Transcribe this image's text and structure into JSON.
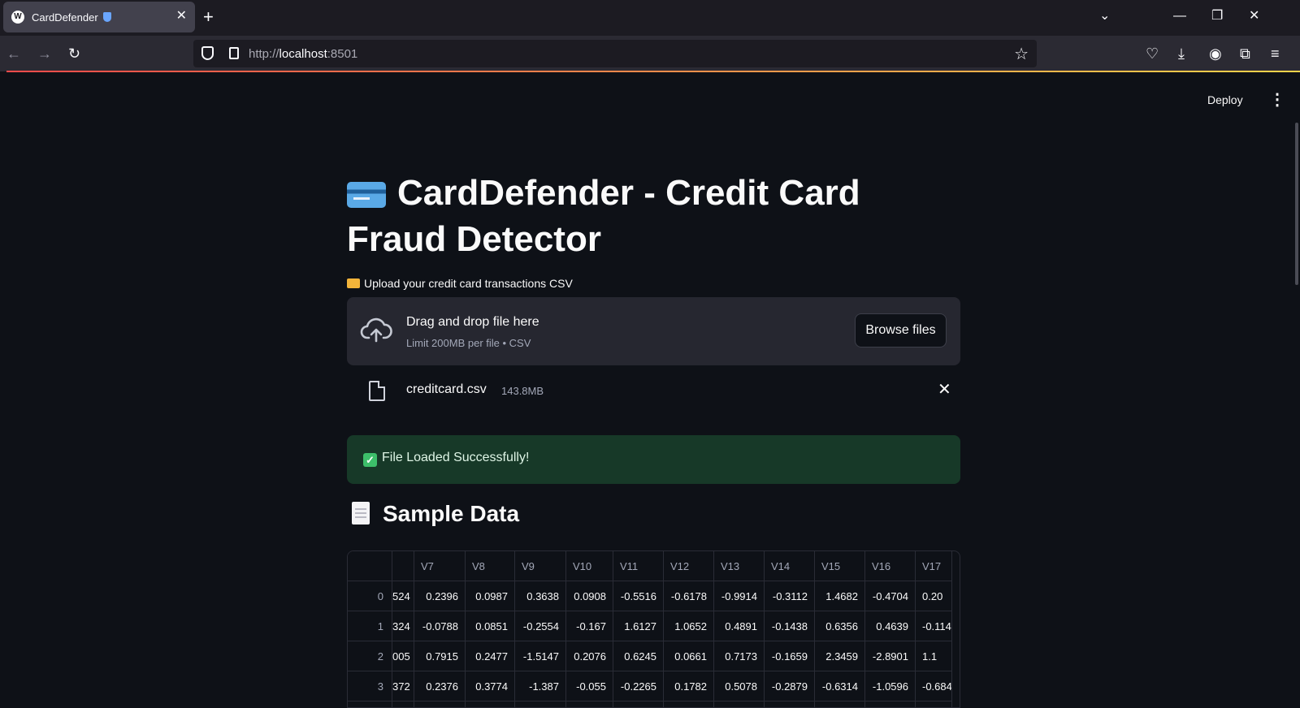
{
  "browser": {
    "tab_title": "CardDefender",
    "tab_favicon": "W",
    "url_prefix": "http://",
    "url_host": "localhost",
    "url_port": ":8501",
    "icons": [
      "back-icon",
      "forward-icon",
      "reload-icon",
      "shield-icon",
      "page-icon",
      "star-icon",
      "pocket-icon",
      "download-icon",
      "account-icon",
      "extensions-icon",
      "menu-icon"
    ]
  },
  "app": {
    "deploy_label": "Deploy",
    "title": "CardDefender - Credit Card Fraud Detector",
    "upload_label": "Upload your credit card transactions CSV",
    "dropzone_title": "Drag and drop file here",
    "dropzone_sub": "Limit 200MB per file • CSV",
    "browse_label": "Browse files",
    "file_name": "creditcard.csv",
    "file_size": "143.8MB",
    "success_text": "File Loaded Successfully!",
    "sample_heading": "Sample Data"
  },
  "table": {
    "index": [
      "0",
      "1",
      "2",
      "3"
    ],
    "columns": [
      "",
      "V7",
      "V8",
      "V9",
      "V10",
      "V11",
      "V12",
      "V13",
      "V14",
      "V15",
      "V16",
      "V17"
    ],
    "rows": [
      [
        "524",
        "0.2396",
        "0.0987",
        "0.3638",
        "0.0908",
        "-0.5516",
        "-0.6178",
        "-0.9914",
        "-0.3112",
        "1.4682",
        "-0.4704",
        "0.20"
      ],
      [
        "324",
        "-0.0788",
        "0.0851",
        "-0.2554",
        "-0.167",
        "1.6127",
        "1.0652",
        "0.4891",
        "-0.1438",
        "0.6356",
        "0.4639",
        "-0.114"
      ],
      [
        "005",
        "0.7915",
        "0.2477",
        "-1.5147",
        "0.2076",
        "0.6245",
        "0.0661",
        "0.7173",
        "-0.1659",
        "2.3459",
        "-2.8901",
        "1.1"
      ],
      [
        "372",
        "0.2376",
        "0.3774",
        "-1.387",
        "-0.055",
        "-0.2265",
        "0.1782",
        "0.5078",
        "-0.2879",
        "-0.6314",
        "-1.0596",
        "-0.684"
      ]
    ]
  }
}
